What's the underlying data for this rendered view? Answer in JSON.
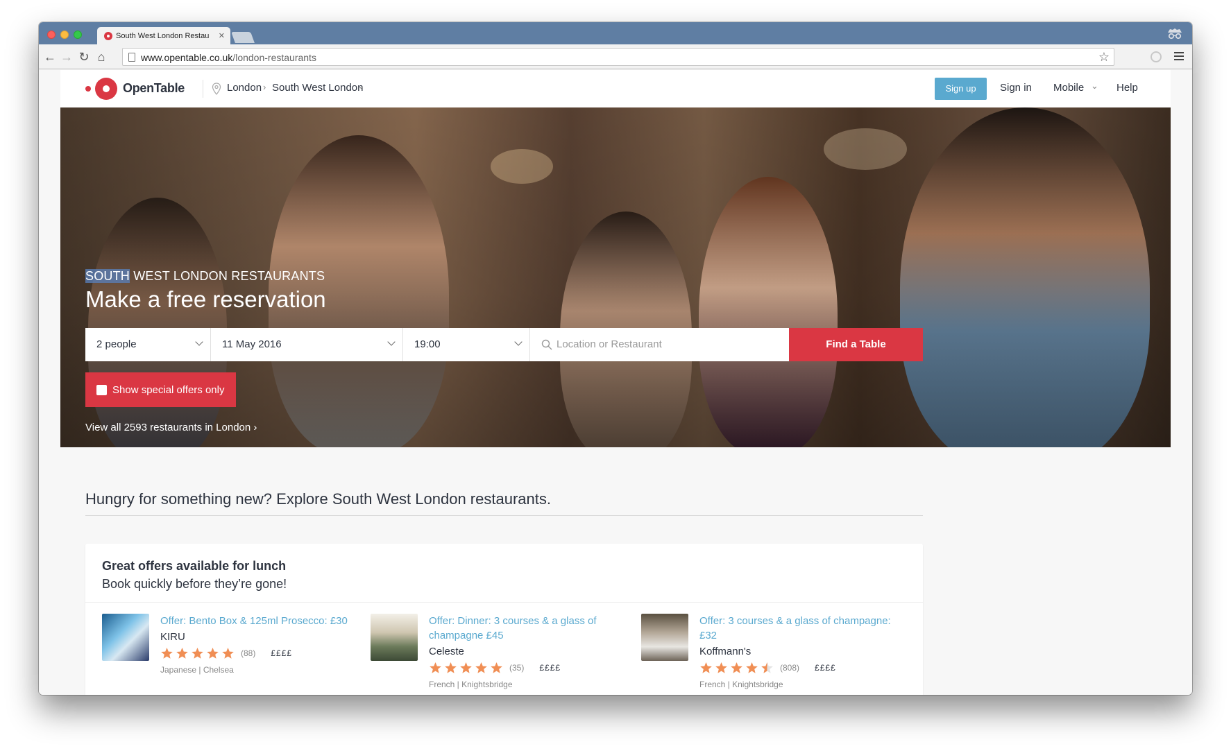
{
  "browser": {
    "tab_title": "South West London Restau",
    "url_host": "www.opentable.co.uk",
    "url_path": "/london-restaurants"
  },
  "header": {
    "logo": "OpenTable",
    "breadcrumb": [
      "London",
      "South West London"
    ],
    "signup_label": "Sign up",
    "signin_label": "Sign in",
    "mobile_label": "Mobile",
    "help_label": "Help"
  },
  "hero": {
    "kicker_selected": "SOUTH",
    "kicker_rest": " WEST LONDON RESTAURANTS",
    "title": "Make a free reservation",
    "party_size": "2 people",
    "date": "11 May 2016",
    "time": "19:00",
    "search_placeholder": "Location or Restaurant",
    "find_button": "Find a Table",
    "offers_toggle": "Show special offers only",
    "view_all": "View all 2593 restaurants in London"
  },
  "explore": {
    "heading": "Hungry for something new? Explore South West London restaurants."
  },
  "offers": {
    "title": "Great offers available for lunch",
    "subtitle": "Book quickly before they’re gone!",
    "items": [
      {
        "offer": "Offer: Bento Box & 125ml Prosecco: £30",
        "name": "KIRU",
        "rating": 5,
        "reviews": "(88)",
        "price": "££££",
        "category": "Japanese | Chelsea"
      },
      {
        "offer": "Offer: Dinner: 3 courses & a glass of champagne £45",
        "name": "Celeste",
        "rating": 5,
        "reviews": "(35)",
        "price": "££££",
        "category": "French | Knightsbridge"
      },
      {
        "offer": "Offer: 3 courses & a glass of champagne: £32",
        "name": "Koffmann's",
        "rating": 4.5,
        "reviews": "(808)",
        "price": "££££",
        "category": "French | Knightsbridge"
      }
    ]
  },
  "colors": {
    "brand_red": "#da3743",
    "link_blue": "#5aa9cf",
    "star_orange": "#f08e54",
    "chrome_blue": "#5f7ea3"
  },
  "icons": [
    "location-pin-icon",
    "chevron-down-icon",
    "chevron-right-icon",
    "search-icon",
    "star-icon",
    "back-icon",
    "forward-icon",
    "reload-icon",
    "home-icon",
    "bookmark-star-icon",
    "menu-icon",
    "incognito-icon"
  ]
}
